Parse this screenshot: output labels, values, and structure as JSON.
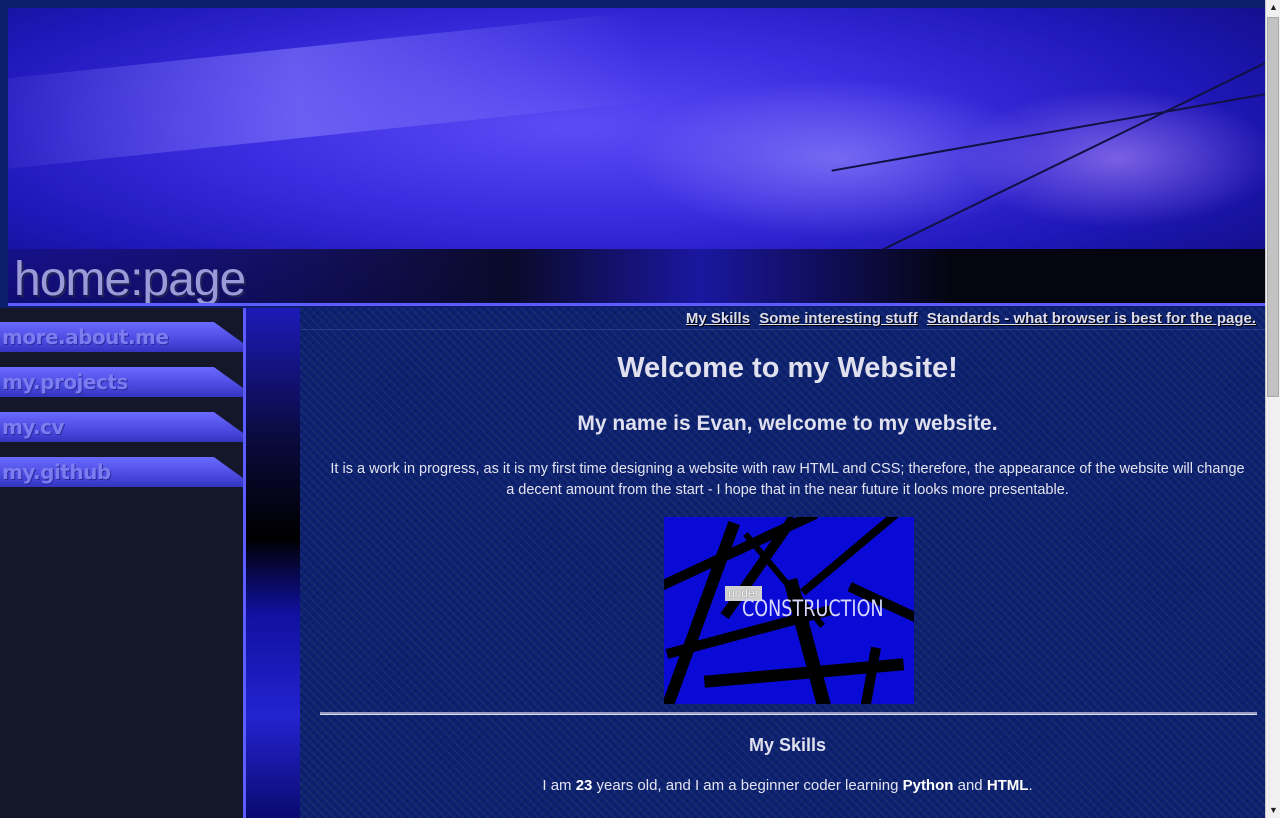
{
  "header": {
    "logo_text": "home:page"
  },
  "sidebar": {
    "items": [
      {
        "label": "more.about.me"
      },
      {
        "label": "my.projects"
      },
      {
        "label": "my.cv"
      },
      {
        "label": "my.github"
      }
    ]
  },
  "topnav": {
    "links": [
      {
        "label": "My Skills"
      },
      {
        "label": "Some interesting stuff"
      },
      {
        "label": "Standards - what browser is best for the page."
      }
    ]
  },
  "main": {
    "title": "Welcome to my Website!",
    "subtitle": "My name is Evan, welcome to my website.",
    "description": "It is a work in progress, as it is my first time designing a website with raw HTML and CSS; therefore, the appearance of the website will change a decent amount from the start - I hope that in the near future it looks more presentable.",
    "construction_image": {
      "line1": "under",
      "line2": "CONSTRUCTION"
    },
    "skills_heading": "My Skills",
    "skills_text": {
      "prefix": "I am ",
      "age": "23",
      "middle": " years old, and I am a beginner coder learning ",
      "lang1": "Python",
      "and": " and ",
      "lang2": "HTML",
      "suffix": "."
    }
  },
  "colors": {
    "accent": "#5c5cff",
    "background": "#0c2170",
    "sidebar_bg": "#14162a",
    "text": "#e0e0ee"
  }
}
